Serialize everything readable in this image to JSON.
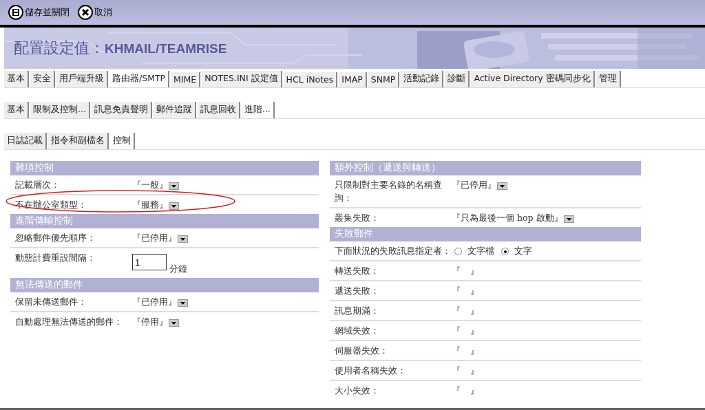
{
  "toolbar": [
    {
      "kind": "save",
      "label": "儲存並關閉"
    },
    {
      "kind": "cancel",
      "label": "取消"
    }
  ],
  "banner": {
    "title": "配置設定值：",
    "server": "KHMAIL/TEAMRISE"
  },
  "tab_rows": [
    [
      {
        "label": "基本",
        "selected": false
      },
      {
        "label": "安全",
        "selected": false
      },
      {
        "label": "用戶端升級",
        "selected": false
      },
      {
        "label": "路由器/SMTP",
        "selected": true
      },
      {
        "label": "MIME",
        "selected": false
      },
      {
        "label": "NOTES.INI 設定值",
        "selected": false
      },
      {
        "label": "HCL iNotes",
        "selected": false
      },
      {
        "label": "IMAP",
        "selected": false
      },
      {
        "label": "SNMP",
        "selected": false
      },
      {
        "label": "活動記錄",
        "selected": false
      },
      {
        "label": "診斷",
        "selected": false
      },
      {
        "label": "Active Directory 密碼同步化",
        "selected": false
      },
      {
        "label": "管理",
        "selected": false
      }
    ],
    [
      {
        "label": "基本",
        "selected": false
      },
      {
        "label": "限制及控制...",
        "selected": false
      },
      {
        "label": "訊息免責聲明",
        "selected": false
      },
      {
        "label": "郵件追蹤",
        "selected": false
      },
      {
        "label": "訊息回收",
        "selected": false
      },
      {
        "label": "進階...",
        "selected": true
      }
    ],
    [
      {
        "label": "日誌記載",
        "selected": false
      },
      {
        "label": "指令和副檔名",
        "selected": false
      },
      {
        "label": "控制",
        "selected": true
      }
    ]
  ],
  "columns": [
    [
      {
        "title": "雜項控制",
        "rows": [
          {
            "kind": "select",
            "label": "記載層次：",
            "value": "『一般』"
          },
          {
            "kind": "select",
            "label": "不在辦公室類型：",
            "value": "『服務』",
            "annotated": true
          }
        ]
      },
      {
        "title": "進階傳輸控制",
        "rows": [
          {
            "kind": "select",
            "label": "忽略郵件優先順序：",
            "value": "『已停用』"
          },
          {
            "kind": "number",
            "label": "動態計費重設間隔：",
            "value": "1",
            "unit": "分鐘"
          }
        ]
      },
      {
        "title": "無法傳送的郵件",
        "rows": [
          {
            "kind": "select",
            "label": "保留未傳送郵件：",
            "value": "『已停用』"
          },
          {
            "kind": "select",
            "label": "自動處理無法傳送的郵件：",
            "value": "『停用』"
          }
        ]
      }
    ],
    [
      {
        "title": "額外控制（遞送與轉送）",
        "rows": [
          {
            "kind": "select",
            "label": "只限制對主要名錄的名稱查詢：",
            "value": "『已停用』"
          },
          {
            "kind": "select",
            "label": "叢集失敗：",
            "value": "『只為最後一個 hop 啟動』"
          }
        ]
      },
      {
        "title": "失敗郵件",
        "rows": [
          {
            "kind": "radio",
            "label": "下面狀況的失敗訊息指定者：",
            "options": [
              {
                "label": "文字檔",
                "selected": false
              },
              {
                "label": "文字",
                "selected": true
              }
            ]
          },
          {
            "kind": "text",
            "label": "轉送失敗：",
            "value": "『』"
          },
          {
            "kind": "text",
            "label": "遞送失敗：",
            "value": "『』"
          },
          {
            "kind": "text",
            "label": "訊息期滿：",
            "value": "『』"
          },
          {
            "kind": "text",
            "label": "網域失效：",
            "value": "『』"
          },
          {
            "kind": "text",
            "label": "伺服器失效：",
            "value": "『』"
          },
          {
            "kind": "text",
            "label": "使用者名稱失效：",
            "value": "『』"
          },
          {
            "kind": "text",
            "label": "大小失效：",
            "value": "『』"
          }
        ]
      }
    ]
  ]
}
